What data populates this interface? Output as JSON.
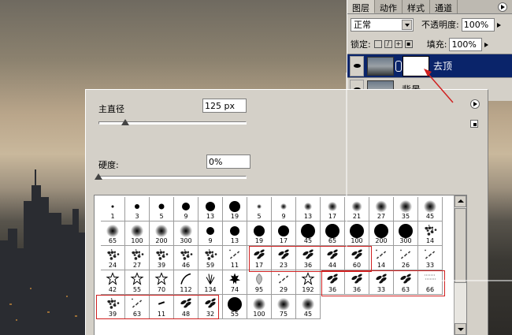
{
  "layers_panel": {
    "tabs": [
      "图层",
      "动作",
      "样式",
      "通道"
    ],
    "active_tab": 0,
    "blend_mode": "正常",
    "opacity_label": "不透明度:",
    "opacity_value": "100%",
    "lock_label": "锁定:",
    "fill_label": "填充:",
    "fill_value": "100%",
    "layers": [
      {
        "name": "去顶",
        "selected": true
      },
      {
        "name": "背景",
        "selected": false
      }
    ]
  },
  "brush_popup": {
    "master_diameter_label": "主直径",
    "master_diameter_value": "125 px",
    "master_diameter_fraction": 0.18,
    "hardness_label": "硬度:",
    "hardness_value": "0%",
    "hardness_fraction": 0.0,
    "brushes": [
      {
        "kind": "hard",
        "size": 1
      },
      {
        "kind": "hard",
        "size": 3
      },
      {
        "kind": "hard",
        "size": 5
      },
      {
        "kind": "hard",
        "size": 9
      },
      {
        "kind": "hard",
        "size": 13
      },
      {
        "kind": "hard",
        "size": 19
      },
      {
        "kind": "soft",
        "size": 5
      },
      {
        "kind": "soft",
        "size": 9
      },
      {
        "kind": "soft",
        "size": 13
      },
      {
        "kind": "soft",
        "size": 17
      },
      {
        "kind": "soft",
        "size": 21
      },
      {
        "kind": "soft",
        "size": 27
      },
      {
        "kind": "soft",
        "size": 35
      },
      {
        "kind": "soft",
        "size": 45
      },
      {
        "kind": "soft",
        "size": 65
      },
      {
        "kind": "soft",
        "size": 100
      },
      {
        "kind": "soft",
        "size": 200
      },
      {
        "kind": "soft",
        "size": 300
      },
      {
        "kind": "hard",
        "size": 9
      },
      {
        "kind": "hard",
        "size": 13
      },
      {
        "kind": "hard",
        "size": 19
      },
      {
        "kind": "hard",
        "size": 17
      },
      {
        "kind": "hard",
        "size": 45
      },
      {
        "kind": "hard",
        "size": 65
      },
      {
        "kind": "hard",
        "size": 100
      },
      {
        "kind": "hard",
        "size": 200
      },
      {
        "kind": "hard",
        "size": 300
      },
      {
        "kind": "splat",
        "size": 14
      },
      {
        "kind": "splat",
        "size": 24
      },
      {
        "kind": "splat",
        "size": 27
      },
      {
        "kind": "splat",
        "size": 39
      },
      {
        "kind": "splat",
        "size": 46
      },
      {
        "kind": "splat",
        "size": 59
      },
      {
        "kind": "scatter",
        "size": 11
      },
      {
        "kind": "leaf",
        "size": 17
      },
      {
        "kind": "leaf",
        "size": 23
      },
      {
        "kind": "leaf",
        "size": 36
      },
      {
        "kind": "leaf",
        "size": 44
      },
      {
        "kind": "leaf",
        "size": 60
      },
      {
        "kind": "scatter",
        "size": 14
      },
      {
        "kind": "scatter",
        "size": 26
      },
      {
        "kind": "scatter",
        "size": 33
      },
      {
        "kind": "star",
        "size": 42
      },
      {
        "kind": "star",
        "size": 55
      },
      {
        "kind": "star",
        "size": 70
      },
      {
        "kind": "stroke",
        "size": 112
      },
      {
        "kind": "grass",
        "size": 134
      },
      {
        "kind": "maple",
        "size": 74
      },
      {
        "kind": "petal",
        "size": 95
      },
      {
        "kind": "scatter",
        "size": 29
      },
      {
        "kind": "star",
        "size": 192
      },
      {
        "kind": "leaf",
        "size": 36
      },
      {
        "kind": "leaf",
        "size": 36
      },
      {
        "kind": "leaf",
        "size": 33
      },
      {
        "kind": "leaf",
        "size": 63
      },
      {
        "kind": "chalk",
        "size": 66
      },
      {
        "kind": "splat",
        "size": 39
      },
      {
        "kind": "scatter",
        "size": 63
      },
      {
        "kind": "dash",
        "size": 11
      },
      {
        "kind": "leaf",
        "size": 48
      },
      {
        "kind": "leaf",
        "size": 32
      },
      {
        "kind": "hard",
        "size": 55
      },
      {
        "kind": "soft",
        "size": 100
      },
      {
        "kind": "soft",
        "size": 75
      },
      {
        "kind": "soft",
        "size": 45
      }
    ]
  },
  "colors": {
    "selection_blue": "#0a246a",
    "annotation_red": "#d02020"
  },
  "icons": [
    "eye-icon",
    "chain-icon",
    "lock-icon",
    "panel-menu-icon"
  ]
}
